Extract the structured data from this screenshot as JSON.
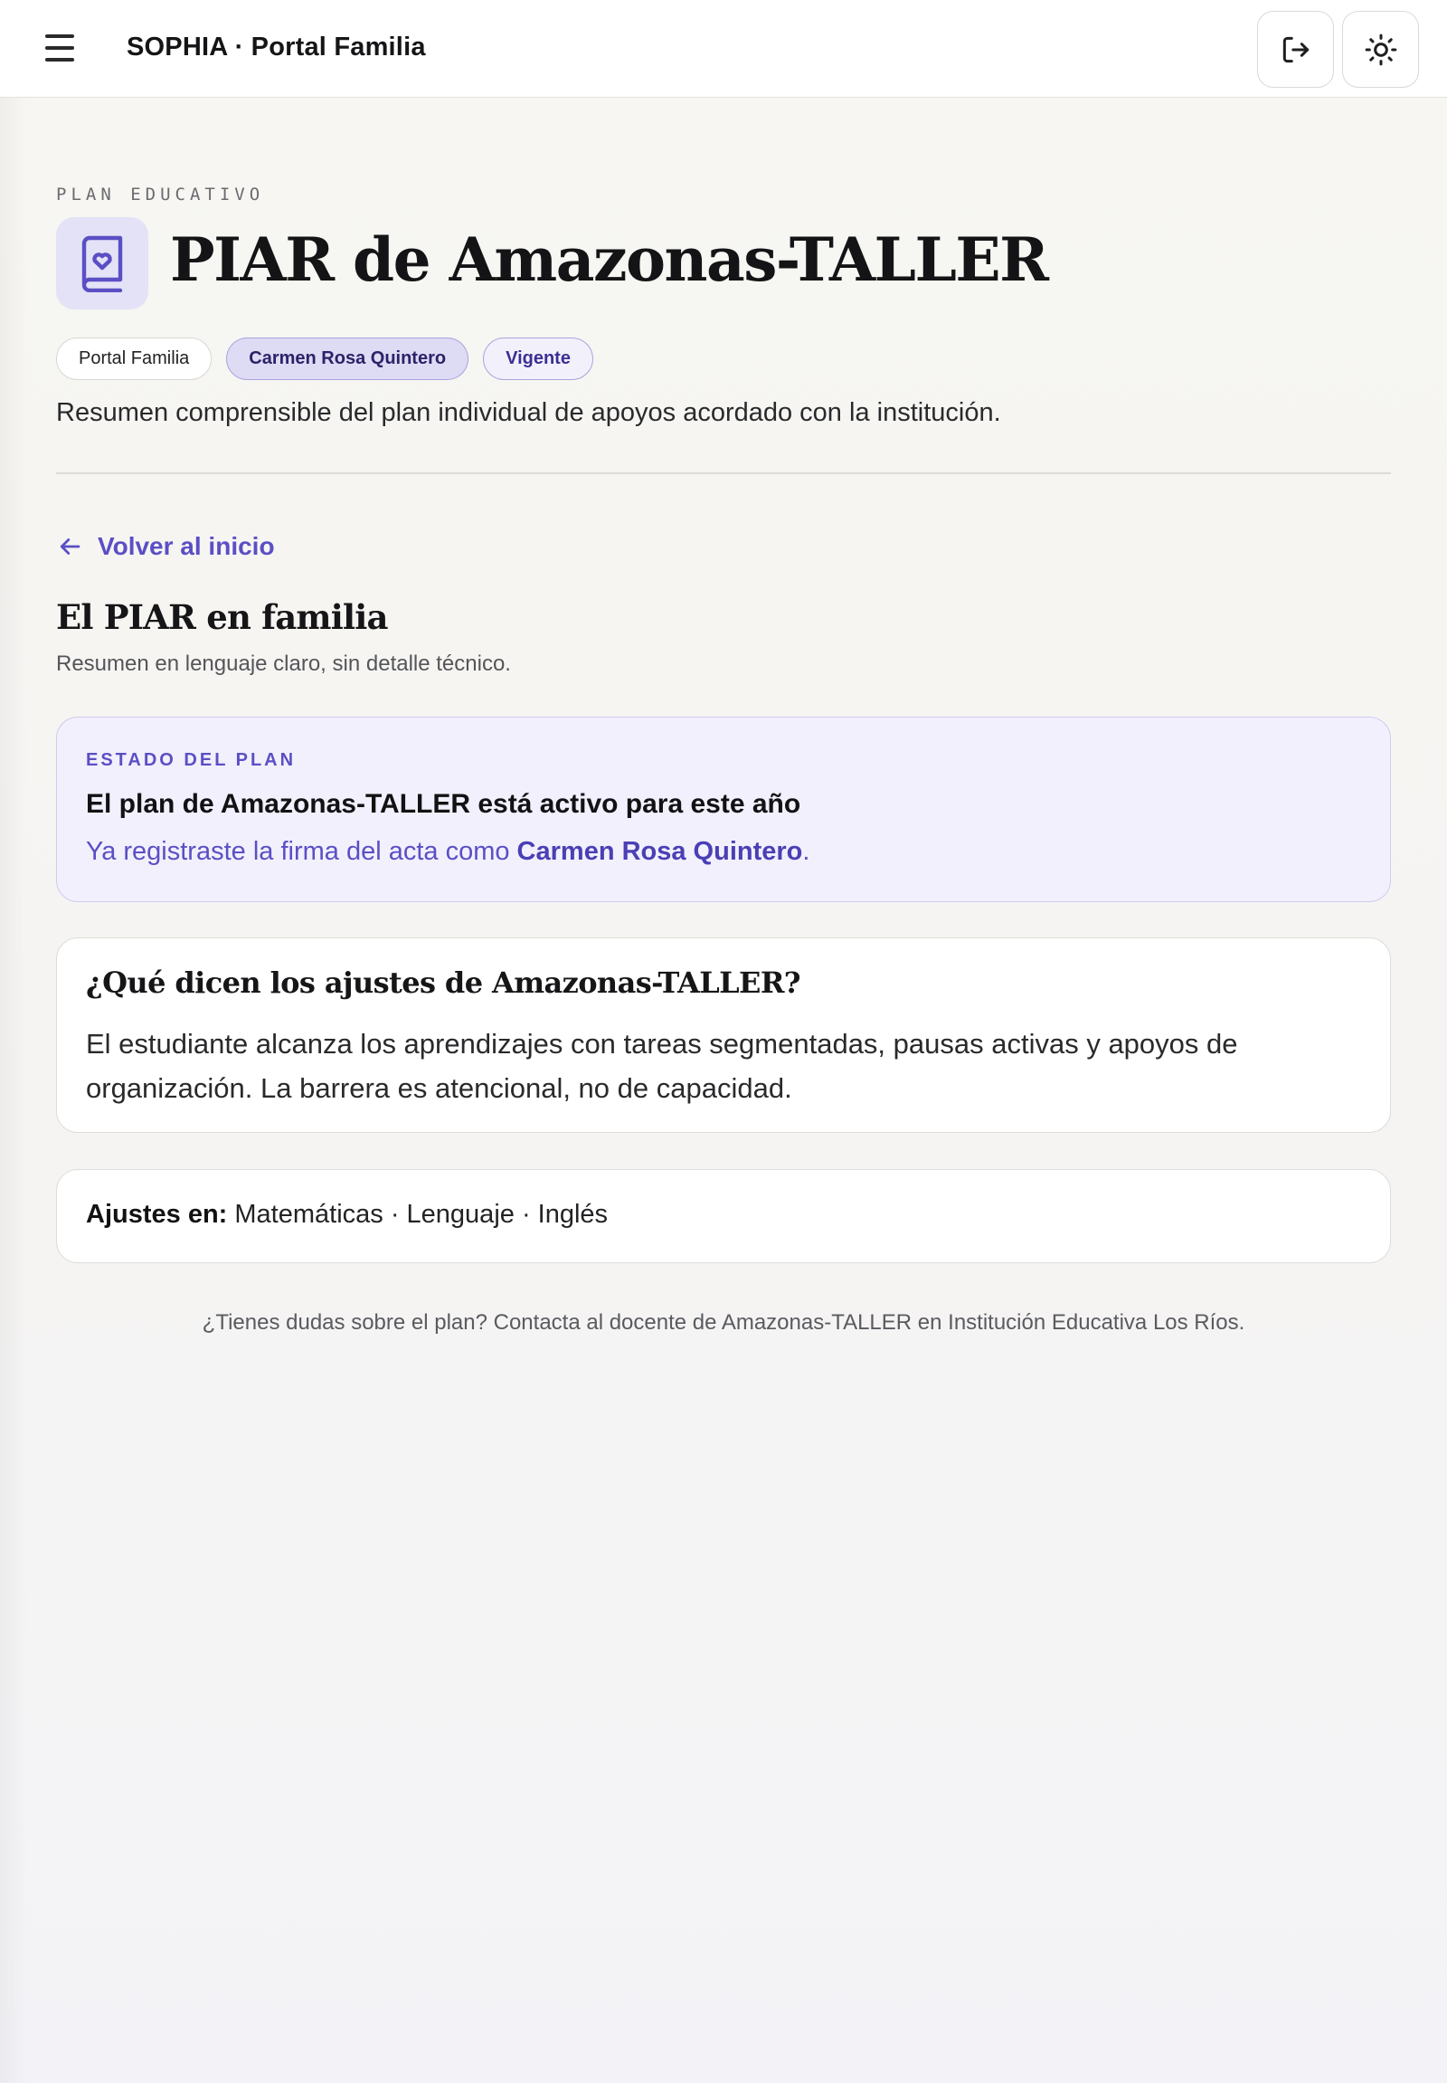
{
  "topbar": {
    "app_title": "SOPHIA · Portal Familia",
    "menu_icon": "hamburger-menu-icon",
    "logout_icon": "logout-icon",
    "theme_icon": "sun-icon"
  },
  "header": {
    "eyebrow": "PLAN EDUCATIVO",
    "icon": "book-heart-icon",
    "title": "PIAR de Amazonas-TALLER",
    "chips": [
      "Portal Familia",
      "Carmen Rosa Quintero",
      "Vigente"
    ],
    "summary": "Resumen comprensible del plan individual de apoyos acordado con la institución."
  },
  "back_link": {
    "icon": "arrow-left-icon",
    "label": "Volver al inicio"
  },
  "section": {
    "title": "El PIAR en familia",
    "subtitle": "Resumen en lenguaje claro, sin detalle técnico."
  },
  "state_card": {
    "label": "ESTADO DEL PLAN",
    "headline": "El plan de Amazonas-TALLER está activo para este año",
    "line_prefix": "Ya registraste la firma del acta como ",
    "line_name": "Carmen Rosa Quintero",
    "line_suffix": "."
  },
  "adjust_card": {
    "question": "¿Qué dicen los ajustes de Amazonas-TALLER?",
    "body": "El estudiante alcanza los aprendizajes con tareas segmentadas, pausas activas y apoyos de organización. La barrera es atencional, no de capacidad."
  },
  "subjects_card": {
    "label": "Ajustes en:",
    "subjects": " Matemáticas · Lenguaje · Inglés"
  },
  "footer_note": "¿Tienes dudas sobre el plan? Contacta al docente de Amazonas-TALLER en Institución Educativa Los Ríos.",
  "colors": {
    "accent": "#5b4fc4",
    "accent_bg": "#f1f0fc",
    "page_bg": "#f7f6f3"
  }
}
